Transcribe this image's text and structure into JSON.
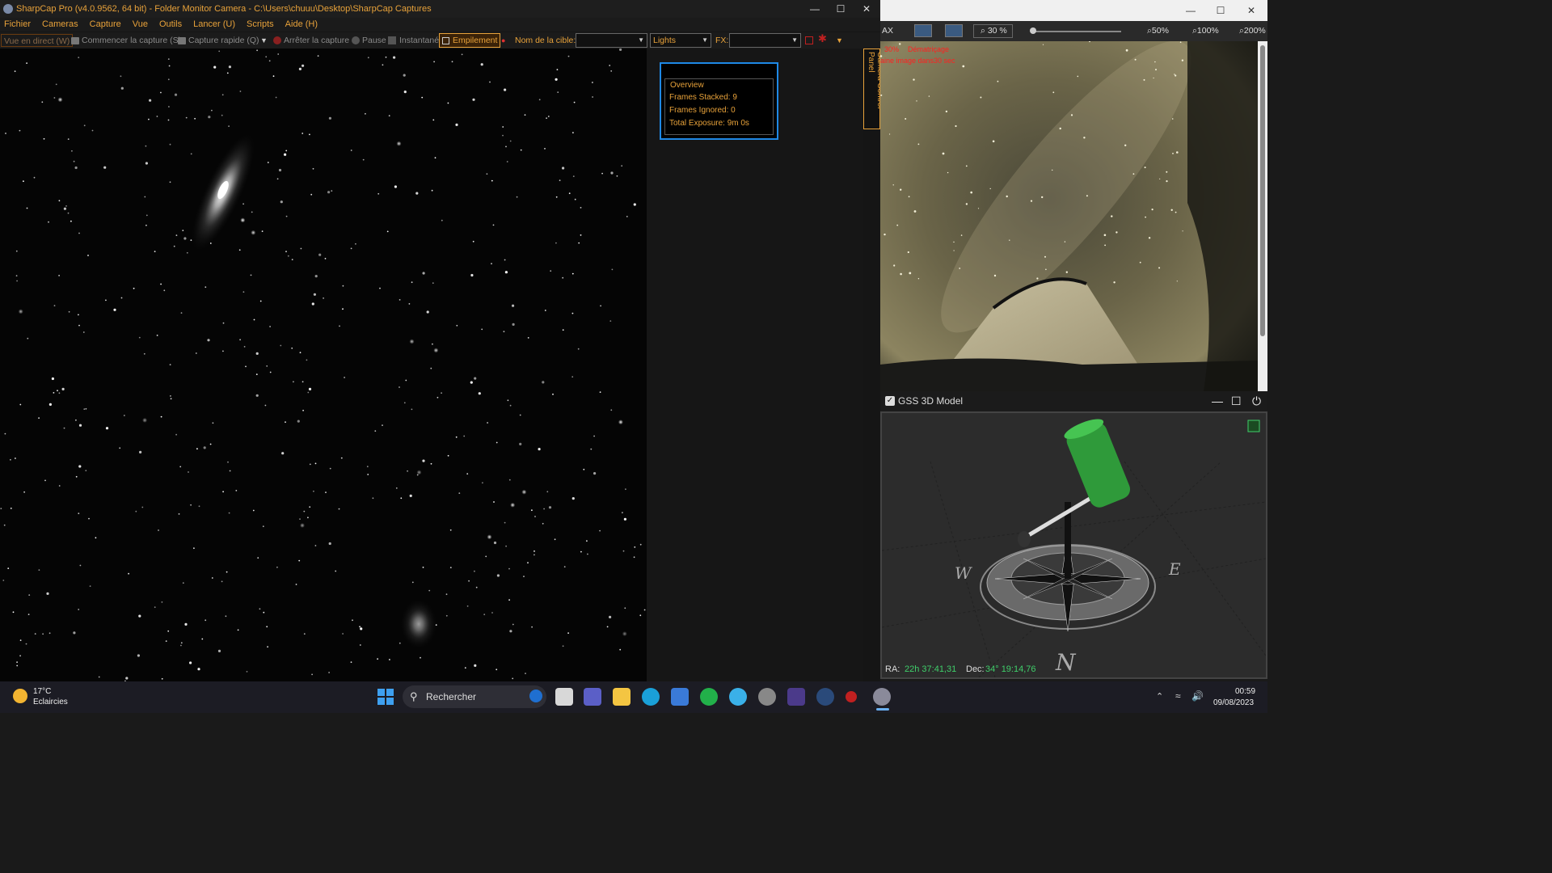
{
  "sharpcap": {
    "title": "SharpCap Pro (v4.0.9562, 64 bit) - Folder Monitor Camera - C:\\Users\\chuuu\\Desktop\\SharpCap Captures",
    "menu": [
      "Fichier",
      "Cameras",
      "Capture",
      "Vue",
      "Outils",
      "Lancer (U)",
      "Scripts",
      "Aide (H)"
    ],
    "toolbar": {
      "live_view": "Vue en direct (W)",
      "start_capture": "Commencer la capture (S)",
      "quick_capture": "Capture rapide (Q)",
      "stop_capture": "Arrêter la capture",
      "pause": "Pause",
      "snapshot": "Instantané",
      "stacking": "Empilement",
      "target_label": "Nom de la cible:",
      "target_value": "",
      "frame_type": "Lights",
      "fx_label": "FX:",
      "fx_value": ""
    },
    "overview": {
      "title": "Overview",
      "frames_stacked": "Frames Stacked: 9",
      "frames_ignored": "Frames Ignored: 0",
      "total_exposure": "Total Exposure:   9m 0s"
    },
    "camera_control_panel": "Camera Control Panel"
  },
  "allsky": {
    "tools": {
      "ax": "AX",
      "zoom_current": "30 %",
      "zoom_50": "50%",
      "zoom_100": "100%",
      "zoom_200": "200%"
    },
    "overlay_line1_a": "30%",
    "overlay_line1_b": "Dématriçage",
    "overlay_line2": "aine image dans30 sec"
  },
  "gss": {
    "title": "GSS 3D Model",
    "ra_label": "RA:",
    "ra_value": "22h 37:41,31",
    "dec_label": "Dec:",
    "dec_value": "34° 19:14,76"
  },
  "taskbar": {
    "weather_temp": "17°C",
    "weather_desc": "Eclaircies",
    "search_placeholder": "Rechercher",
    "time": "00:59",
    "date": "09/08/2023"
  },
  "colors": {
    "accent_orange": "#e8a23a",
    "highlight_blue": "#1e88e5",
    "ra_green": "#3fcf6a"
  }
}
